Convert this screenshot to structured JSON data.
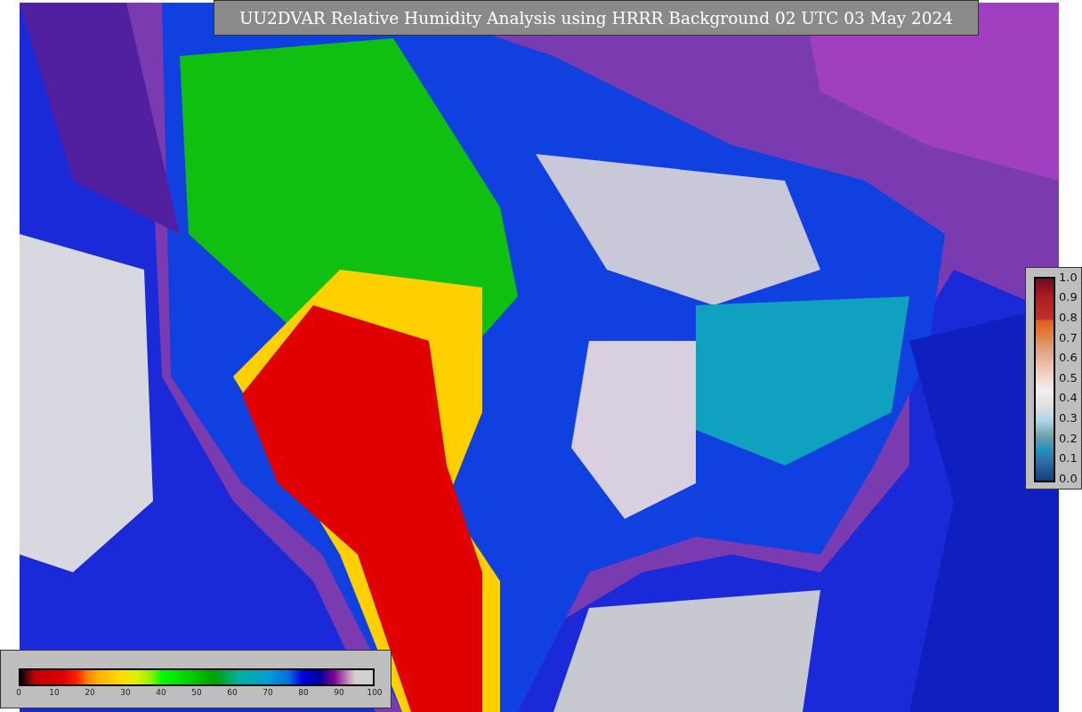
{
  "title": "UU2DVAR Relative Humidity Analysis using HRRR Background 02 UTC 03 May 2024",
  "humidity_colorbar": {
    "ticks": [
      "0",
      "10",
      "20",
      "30",
      "40",
      "50",
      "60",
      "70",
      "80",
      "90",
      "100"
    ]
  },
  "side_colorbar": {
    "ticks": [
      "1.0",
      "0.9",
      "0.8",
      "0.7",
      "0.6",
      "0.5",
      "0.4",
      "0.3",
      "0.2",
      "0.1",
      "0.0"
    ]
  }
}
